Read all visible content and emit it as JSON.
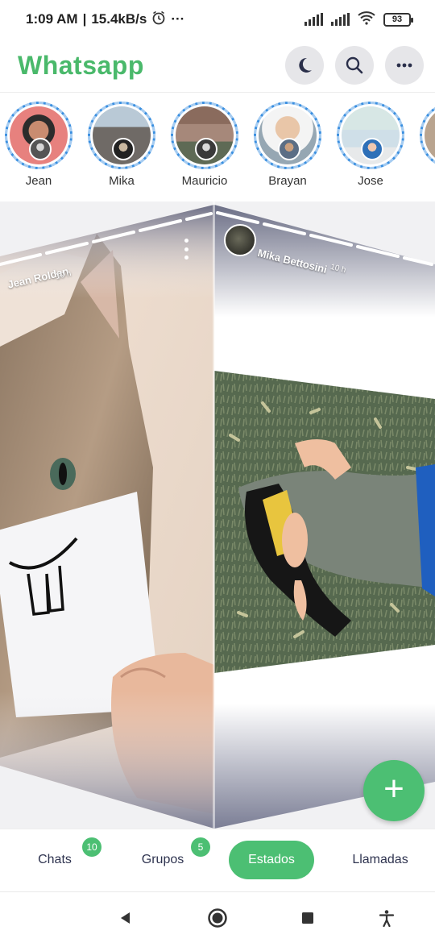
{
  "status_bar": {
    "time": "1:09 AM",
    "separator": "|",
    "speed": "15.4kB/s",
    "overflow": "···",
    "battery": "93",
    "icons": [
      "alarm-icon",
      "signal-icon",
      "signal-icon",
      "wifi-icon",
      "battery-icon"
    ]
  },
  "header": {
    "title": "Whatsapp",
    "actions": [
      "moon-icon",
      "search-icon",
      "more-icon"
    ]
  },
  "stories": [
    {
      "name": "Jean"
    },
    {
      "name": "Mika"
    },
    {
      "name": "Mauricio"
    },
    {
      "name": "Brayan"
    },
    {
      "name": "Jose"
    }
  ],
  "status_viewer": {
    "left": {
      "author": "Jean Roldan",
      "time": "10 h"
    },
    "right": {
      "author": "Mika Bettosini",
      "time": "10 h"
    }
  },
  "fab": {
    "label": "+"
  },
  "tabs": [
    {
      "label": "Chats",
      "badge": "10",
      "active": false
    },
    {
      "label": "Grupos",
      "badge": "5",
      "active": false
    },
    {
      "label": "Estados",
      "badge": "",
      "active": true
    },
    {
      "label": "Llamadas",
      "badge": "",
      "active": false
    }
  ],
  "nav": [
    "back-icon",
    "home-icon",
    "recents-icon",
    "accessibility-icon"
  ],
  "colors": {
    "brand": "#4ab96b",
    "accent": "#4cbf73",
    "ring": "#3a8fe0",
    "text": "#2f3450"
  }
}
